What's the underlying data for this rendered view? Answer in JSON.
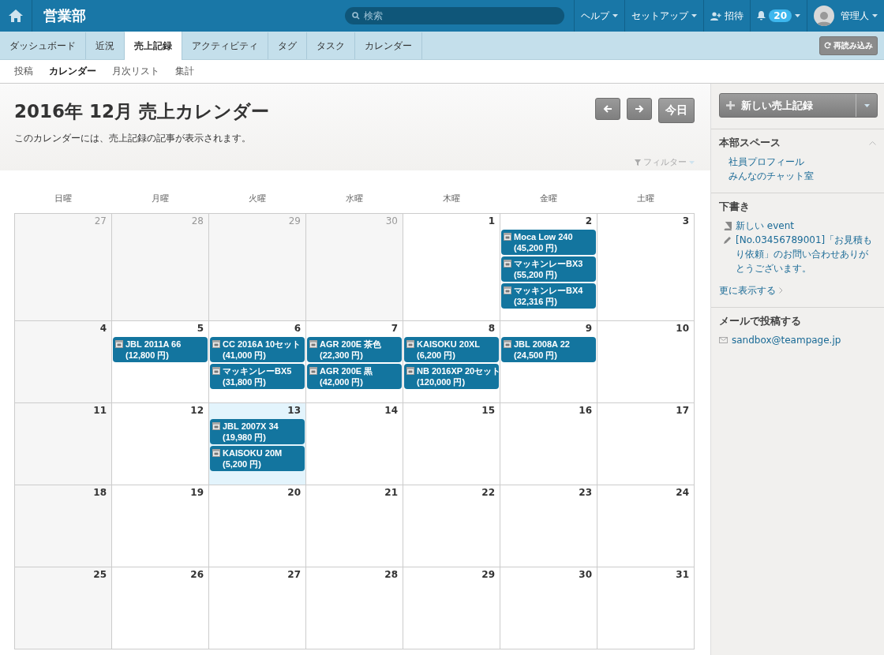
{
  "header": {
    "title": "営業部",
    "search": {
      "placeholder": "検索"
    },
    "menus": [
      {
        "label": "ヘルプ",
        "kind": "dropdown"
      },
      {
        "label": "セットアップ",
        "kind": "dropdown"
      },
      {
        "label": "招待",
        "kind": "invite"
      }
    ],
    "notifications": {
      "count": "20"
    },
    "user": {
      "name": "管理人"
    }
  },
  "tabs": [
    {
      "label": "ダッシュボード",
      "selected": false
    },
    {
      "label": "近況",
      "selected": false
    },
    {
      "label": "売上記録",
      "selected": true
    },
    {
      "label": "アクティビティ",
      "selected": false
    },
    {
      "label": "タグ",
      "selected": false
    },
    {
      "label": "タスク",
      "selected": false
    },
    {
      "label": "カレンダー",
      "selected": false
    }
  ],
  "reload_button": "再読み込み",
  "subnav": [
    {
      "label": "投稿",
      "selected": false
    },
    {
      "label": "カレンダー",
      "selected": true
    },
    {
      "label": "月次リスト",
      "selected": false
    },
    {
      "label": "集計",
      "selected": false
    }
  ],
  "calendar": {
    "title": "2016年 12月 売上カレンダー",
    "description": "このカレンダーには、売上記録の記事が表示されます。",
    "today_button": "今日",
    "filter": "フィルター",
    "weekdays": [
      "日曜",
      "月曜",
      "火曜",
      "水曜",
      "木曜",
      "金曜",
      "土曜"
    ],
    "weeks": [
      [
        {
          "day": "27",
          "other_month": true,
          "today": false
        },
        {
          "day": "28",
          "other_month": true,
          "today": false
        },
        {
          "day": "29",
          "other_month": true,
          "today": false
        },
        {
          "day": "30",
          "other_month": true,
          "today": false
        },
        {
          "day": "1",
          "other_month": false,
          "today": false
        },
        {
          "day": "2",
          "other_month": false,
          "today": false,
          "events": [
            {
              "name": "Moca Low 240",
              "amount": "(45,200 円)"
            },
            {
              "name": "マッキンレーBX3",
              "amount": "(55,200 円)"
            },
            {
              "name": "マッキンレーBX4",
              "amount": "(32,316 円)"
            }
          ]
        },
        {
          "day": "3",
          "other_month": false,
          "today": false
        }
      ],
      [
        {
          "day": "4",
          "other_month": false,
          "today": false
        },
        {
          "day": "5",
          "other_month": false,
          "today": false,
          "events": [
            {
              "name": "JBL 2011A 66",
              "amount": "(12,800 円)"
            }
          ]
        },
        {
          "day": "6",
          "other_month": false,
          "today": false,
          "events": [
            {
              "name": "CC 2016A 10セット",
              "amount": "(41,000 円)"
            },
            {
              "name": "マッキンレーBX5",
              "amount": "(31,800 円)"
            }
          ]
        },
        {
          "day": "7",
          "other_month": false,
          "today": false,
          "events": [
            {
              "name": "AGR 200E 茶色",
              "amount": "(22,300 円)"
            },
            {
              "name": "AGR 200E 黒",
              "amount": "(42,000 円)"
            }
          ]
        },
        {
          "day": "8",
          "other_month": false,
          "today": false,
          "events": [
            {
              "name": "KAISOKU 20XL",
              "amount": "(6,200 円)"
            },
            {
              "name": "NB 2016XP 20セット",
              "amount": "(120,000 円)"
            }
          ]
        },
        {
          "day": "9",
          "other_month": false,
          "today": false,
          "events": [
            {
              "name": "JBL 2008A 22",
              "amount": "(24,500 円)"
            }
          ]
        },
        {
          "day": "10",
          "other_month": false,
          "today": false
        }
      ],
      [
        {
          "day": "11",
          "other_month": false,
          "today": false
        },
        {
          "day": "12",
          "other_month": false,
          "today": false
        },
        {
          "day": "13",
          "other_month": false,
          "today": true,
          "events": [
            {
              "name": "JBL 2007X 34",
              "amount": "(19,980 円)"
            },
            {
              "name": "KAISOKU 20M",
              "amount": "(5,200 円)"
            }
          ]
        },
        {
          "day": "14",
          "other_month": false,
          "today": false
        },
        {
          "day": "15",
          "other_month": false,
          "today": false
        },
        {
          "day": "16",
          "other_month": false,
          "today": false
        },
        {
          "day": "17",
          "other_month": false,
          "today": false
        }
      ],
      [
        {
          "day": "18",
          "other_month": false,
          "today": false
        },
        {
          "day": "19",
          "other_month": false,
          "today": false
        },
        {
          "day": "20",
          "other_month": false,
          "today": false
        },
        {
          "day": "21",
          "other_month": false,
          "today": false
        },
        {
          "day": "22",
          "other_month": false,
          "today": false
        },
        {
          "day": "23",
          "other_month": false,
          "today": false
        },
        {
          "day": "24",
          "other_month": false,
          "today": false
        }
      ],
      [
        {
          "day": "25",
          "other_month": false,
          "today": false
        },
        {
          "day": "26",
          "other_month": false,
          "today": false
        },
        {
          "day": "27",
          "other_month": false,
          "today": false
        },
        {
          "day": "28",
          "other_month": false,
          "today": false
        },
        {
          "day": "29",
          "other_month": false,
          "today": false
        },
        {
          "day": "30",
          "other_month": false,
          "today": false
        },
        {
          "day": "31",
          "other_month": false,
          "today": false
        }
      ]
    ]
  },
  "sidebar": {
    "new_button": "新しい売上記録",
    "space": {
      "title": "本部スペース",
      "links": [
        "社員プロフィール",
        "みんなのチャット室"
      ]
    },
    "drafts": {
      "title": "下書き",
      "items": [
        {
          "kind": "page",
          "text": "新しい event"
        },
        {
          "kind": "edit",
          "text": "[No.03456789001]「お見積もり依頼」のお問い合わせありがとうございます。"
        }
      ],
      "more": "更に表示する"
    },
    "email": {
      "title": "メールで投稿する",
      "address": "sandbox@teampage.jp"
    }
  }
}
